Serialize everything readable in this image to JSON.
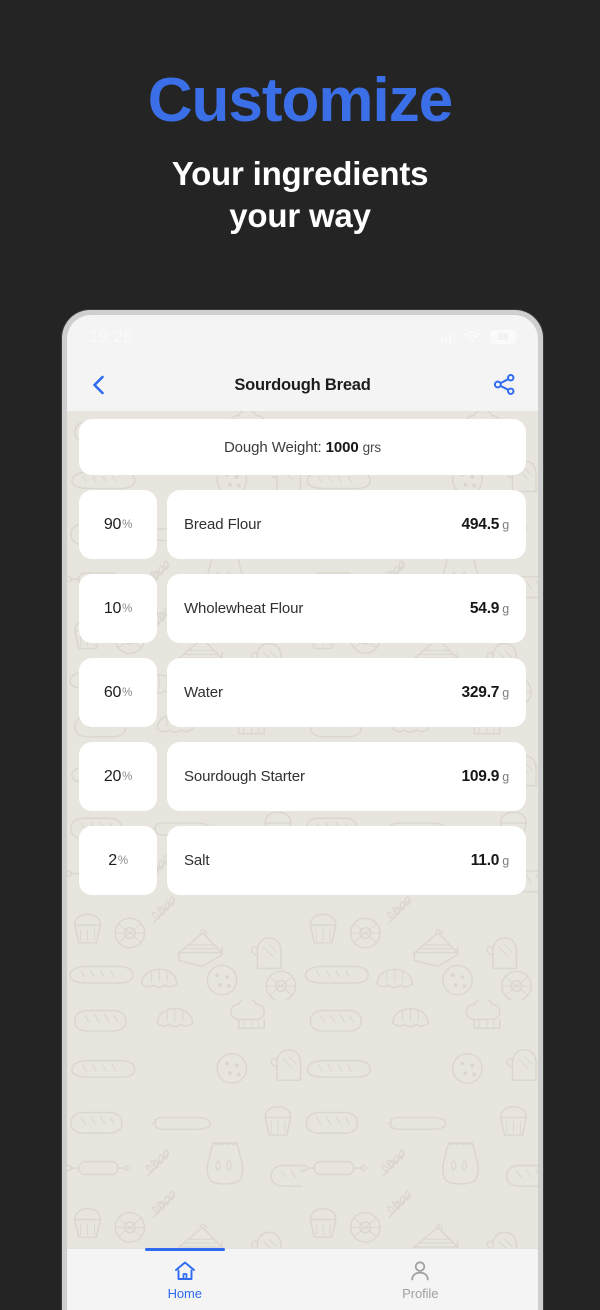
{
  "promo": {
    "title": "Customize",
    "subtitle_line1": "Your ingredients",
    "subtitle_line2": "your way",
    "title_color": "#3b6fe8",
    "background_color": "#242424"
  },
  "phone": {
    "status_bar": {
      "time": "19:28",
      "battery_level": "59",
      "signal_icon": "signal-bars-icon",
      "wifi_icon": "wifi-icon",
      "battery_icon": "battery-icon"
    },
    "app_bar": {
      "back_icon": "chevron-left-icon",
      "title": "Sourdough Bread",
      "share_icon": "share-icon",
      "accent_color": "#2f6bf0"
    },
    "dough_weight": {
      "label": "Dough Weight:",
      "value": "1000",
      "unit": "grs"
    },
    "ingredients": [
      {
        "percent": "90",
        "percent_symbol": "%",
        "name": "Bread Flour",
        "amount": "494.5",
        "unit": "g"
      },
      {
        "percent": "10",
        "percent_symbol": "%",
        "name": "Wholewheat Flour",
        "amount": "54.9",
        "unit": "g"
      },
      {
        "percent": "60",
        "percent_symbol": "%",
        "name": "Water",
        "amount": "329.7",
        "unit": "g"
      },
      {
        "percent": "20",
        "percent_symbol": "%",
        "name": "Sourdough Starter",
        "amount": "109.9",
        "unit": "g"
      },
      {
        "percent": "2",
        "percent_symbol": "%",
        "name": "Salt",
        "amount": "11.0",
        "unit": "g"
      }
    ],
    "bottom_nav": [
      {
        "label": "Home",
        "icon": "home-icon",
        "active": true
      },
      {
        "label": "Profile",
        "icon": "person-icon",
        "active": false
      }
    ],
    "background_color": "#e8e5df"
  }
}
